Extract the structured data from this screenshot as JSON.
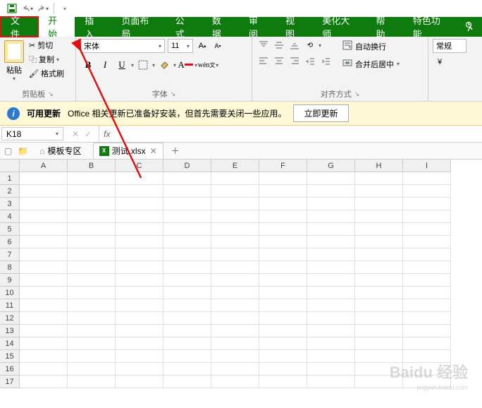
{
  "titlebar": {
    "save": "保存"
  },
  "tabs": {
    "file": "文件",
    "home": "开始",
    "insert": "插入",
    "layout": "页面布局",
    "formula": "公式",
    "data": "数据",
    "review": "审阅",
    "view": "视图",
    "beauty": "美化大师",
    "help": "帮助",
    "special": "特色功能"
  },
  "clipboard": {
    "paste": "粘贴",
    "cut": "剪切",
    "copy": "复制",
    "format": "格式刷",
    "group": "剪贴板"
  },
  "font": {
    "name": "宋体",
    "size": "11",
    "group": "字体",
    "bold": "B",
    "italic": "I",
    "underline": "U"
  },
  "align": {
    "wrap": "自动换行",
    "merge": "合并后居中",
    "group": "对齐方式"
  },
  "number": {
    "general": "常规"
  },
  "update": {
    "title": "可用更新",
    "msg": "Office 相关更新已准备好安装，但首先需要关闭一些应用。",
    "button": "立即更新"
  },
  "namebox": "K18",
  "fx": "fx",
  "sheets": {
    "templates": "模板专区",
    "file": "测试.xlsx"
  },
  "columns": [
    "A",
    "B",
    "C",
    "D",
    "E",
    "F",
    "G",
    "H",
    "I"
  ],
  "rows": [
    "1",
    "2",
    "3",
    "4",
    "5",
    "6",
    "7",
    "8",
    "9",
    "10",
    "11",
    "12",
    "13",
    "14",
    "15",
    "16",
    "17"
  ],
  "watermark": "Baidu 经验",
  "watermark_sub": "jingyan.baidu.com"
}
